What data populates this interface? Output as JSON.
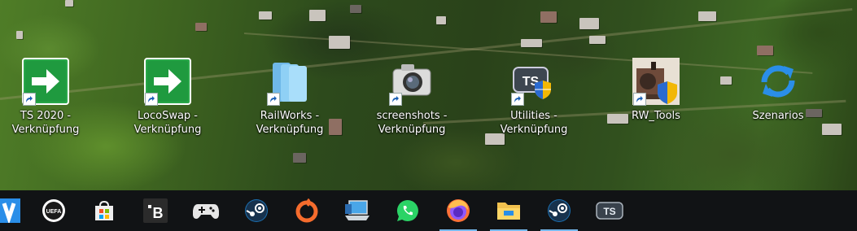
{
  "desktop": {
    "icons": [
      {
        "label": "TS 2020 - Verknüpfung",
        "icon": "green-arrow-shortcut-icon"
      },
      {
        "label": "LocoSwap - Verknüpfung",
        "icon": "green-arrow-shortcut-icon"
      },
      {
        "label": "RailWorks - Verknüpfung",
        "icon": "folder-stack-icon"
      },
      {
        "label": "screenshots - Verknüpfung",
        "icon": "camera-icon"
      },
      {
        "label": "Utilities - Verknüpfung",
        "icon": "ts-shield-icon"
      },
      {
        "label": "RW_Tools",
        "icon": "locomotive-shield-icon"
      },
      {
        "label": "Szenarios",
        "icon": "blue-sync-icon"
      }
    ]
  },
  "taskbar": {
    "items": [
      {
        "icon": "vpn-v-icon"
      },
      {
        "icon": "uefa-icon"
      },
      {
        "icon": "microsoft-store-icon"
      },
      {
        "icon": "b-app-icon"
      },
      {
        "icon": "gamepad-icon"
      },
      {
        "icon": "steam-icon"
      },
      {
        "icon": "origin-icon"
      },
      {
        "icon": "laptop-icon"
      },
      {
        "icon": "whatsapp-icon"
      },
      {
        "icon": "firefox-icon",
        "running": true
      },
      {
        "icon": "file-explorer-icon",
        "running": true
      },
      {
        "icon": "steam-icon",
        "running": true
      },
      {
        "icon": "train-simulator-icon"
      }
    ],
    "ts_text": "TS",
    "b_text": "B",
    "uefa_text": "UEFA"
  },
  "colors": {
    "taskbar_bg": "#111315",
    "running_indicator": "#76b9ed",
    "arrow_green": "#1e9e3a"
  }
}
